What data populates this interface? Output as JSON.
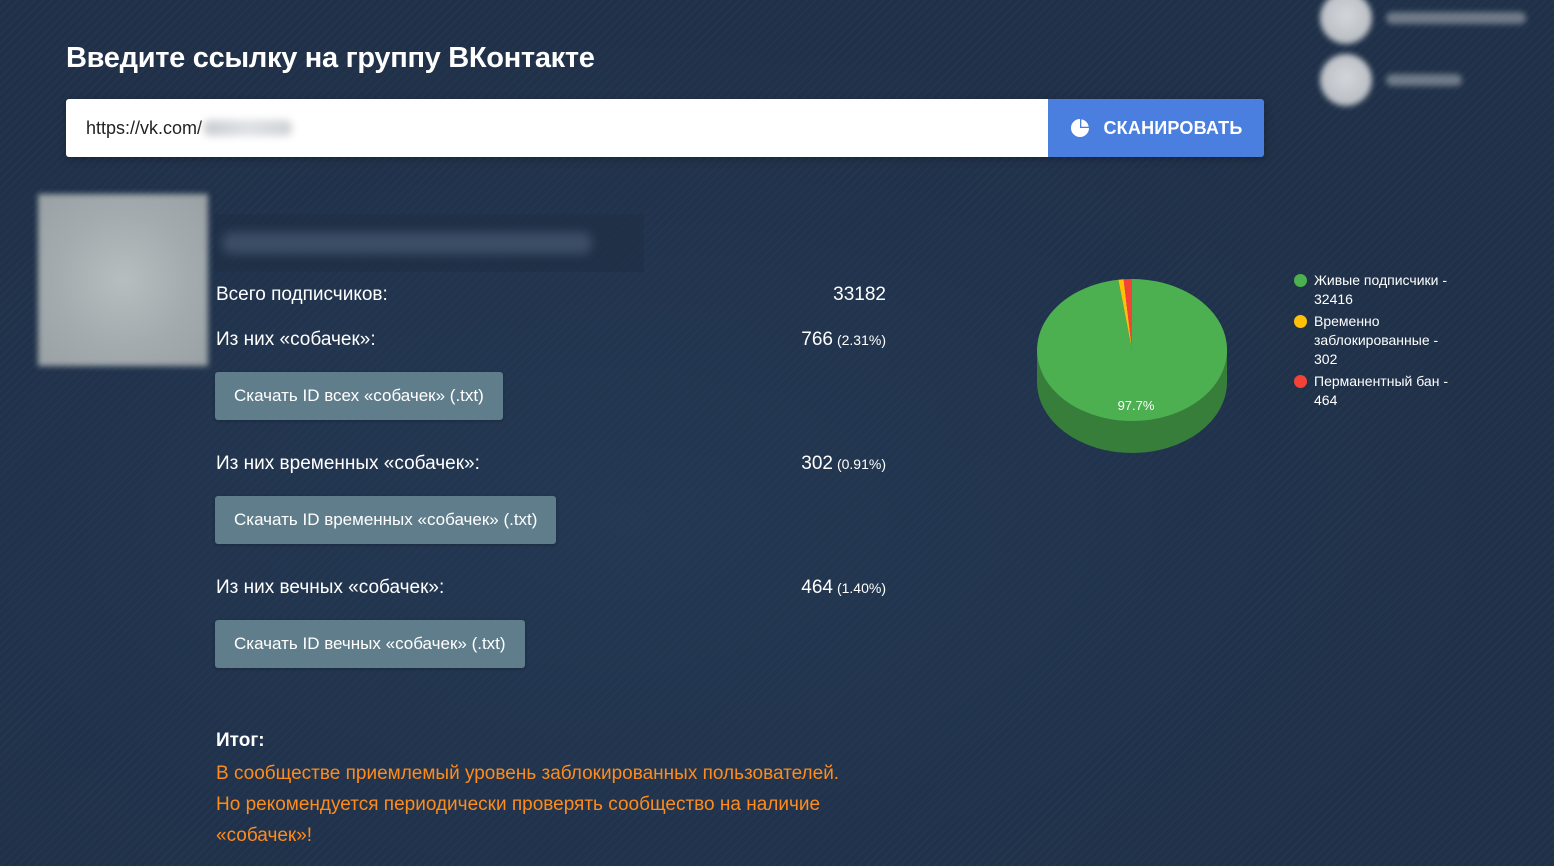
{
  "header": {
    "title": "Введите ссылку на группу ВКонтакте"
  },
  "search": {
    "url_prefix": "https://vk.com/",
    "scan_label": "СКАНИРОВАТЬ"
  },
  "colors": {
    "accent": "#4a7fe0",
    "button": "#607d8b",
    "warning": "#ff8c1a",
    "live": "#4caf50",
    "temp": "#ffc107",
    "perm": "#f44336"
  },
  "stats": {
    "total_label": "Всего подписчиков:",
    "total_value": "33182",
    "dogs_label": "Из них «собачек»:",
    "dogs_value": "766",
    "dogs_pct": "(2.31%)",
    "dogs_button": "Скачать ID всех «собачек» (.txt)",
    "temp_label": "Из них временных «собачек»:",
    "temp_value": "302",
    "temp_pct": "(0.91%)",
    "temp_button": "Скачать ID временных «собачек» (.txt)",
    "perm_label": "Из них вечных «собачек»:",
    "perm_value": "464",
    "perm_pct": "(1.40%)",
    "perm_button": "Скачать ID вечных «собачек» (.txt)"
  },
  "result": {
    "title": "Итог:",
    "line1": "В сообществе приемлемый уровень заблокированных пользователей.",
    "line2": "Но рекомендуется периодически проверять сообщество на наличие",
    "line3": "«собачек»!"
  },
  "legend": {
    "live": "Живые подписчики - 32416",
    "temp": "Временно заблокированные - 302",
    "perm": "Перманентный бан - 464"
  },
  "chart_data": {
    "type": "pie",
    "categories": [
      "Живые подписчики",
      "Временно заблокированные",
      "Перманентный бан"
    ],
    "values": [
      32416,
      302,
      464
    ],
    "colors": [
      "#4caf50",
      "#ffc107",
      "#f44336"
    ],
    "data_labels": [
      "97.7%"
    ],
    "legend_position": "right"
  }
}
